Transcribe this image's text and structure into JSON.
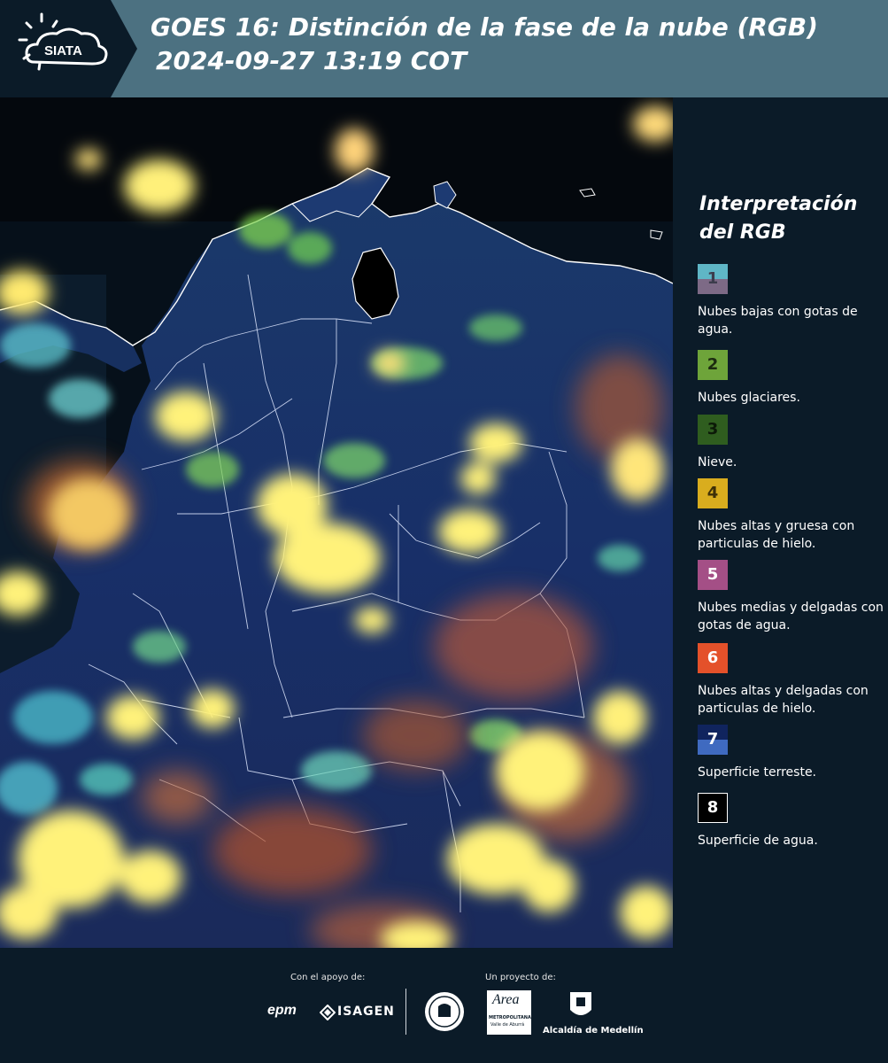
{
  "header": {
    "logo_text": "SIATA",
    "title_line1": "GOES 16: Distinción de la fase de la nube (RGB)",
    "title_line2": "2024-09-27 13:19 COT"
  },
  "legend": {
    "title": "Interpretación del RGB",
    "items": [
      {
        "number": "1",
        "label": "Nubes bajas con gotas de agua.",
        "color_top": "#5fb6c6",
        "color_bottom": "#7d6a86"
      },
      {
        "number": "2",
        "label": "Nubes glaciares.",
        "color": "#6ea43a"
      },
      {
        "number": "3",
        "label": "Nieve.",
        "color": "#2f5d1f"
      },
      {
        "number": "4",
        "label": "Nubes altas y gruesa con particulas de hielo.",
        "color": "#d9ad1e"
      },
      {
        "number": "5",
        "label": "Nubes medias y delgadas con gotas de agua.",
        "color": "#a44f86"
      },
      {
        "number": "6",
        "label": "Nubes altas y delgadas con particulas de hielo.",
        "color": "#e4512a"
      },
      {
        "number": "7",
        "label": "Superficie terreste.",
        "color_top": "#10245e",
        "color_bottom": "#3f6ac0"
      },
      {
        "number": "8",
        "label": "Superficie de agua.",
        "color": "#000000"
      }
    ]
  },
  "footer": {
    "support_label": "Con el apoyo de:",
    "project_label": "Un proyecto de:",
    "logos": [
      "epm",
      "ISAGEN",
      "Área Metropolitana",
      "Alcaldía de Medellín"
    ],
    "area_line1": "Area",
    "area_line2": "METROPOLITANA",
    "area_line3": "Valle de Aburrá",
    "alcaldia": "Alcaldía de Medellín"
  },
  "colors": {
    "header_bg": "#4c7181",
    "panel_bg": "#0b1b28",
    "land": "#1a2e6e",
    "water": "#050a10",
    "cloud_yellow": "#fff27a",
    "cloud_orange": "#e07a3a",
    "cloud_cyan": "#7fe6e6"
  }
}
